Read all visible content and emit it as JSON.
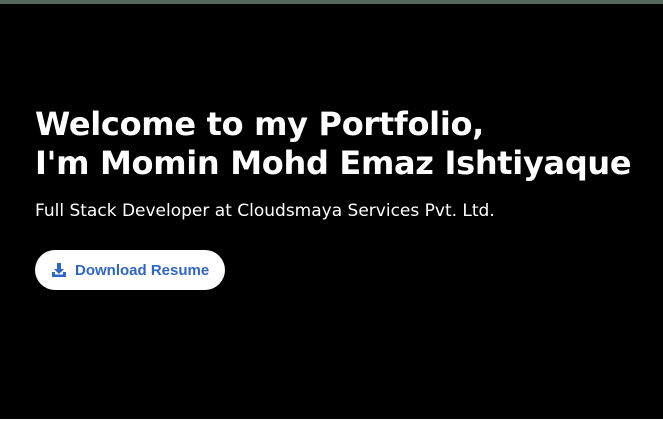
{
  "hero": {
    "title_line1": "Welcome to my Portfolio,",
    "title_line2": "I'm Momin Mohd Emaz Ishtiyaque",
    "subtitle": "Full Stack Developer at Cloudsmaya Services Pvt. Ltd.",
    "download_button": {
      "label": "Download Resume",
      "icon": "download-icon"
    }
  },
  "colors": {
    "background": "#000000",
    "accent": "#2f66c4",
    "text": "#ffffff",
    "top_strip": "#56685e"
  }
}
